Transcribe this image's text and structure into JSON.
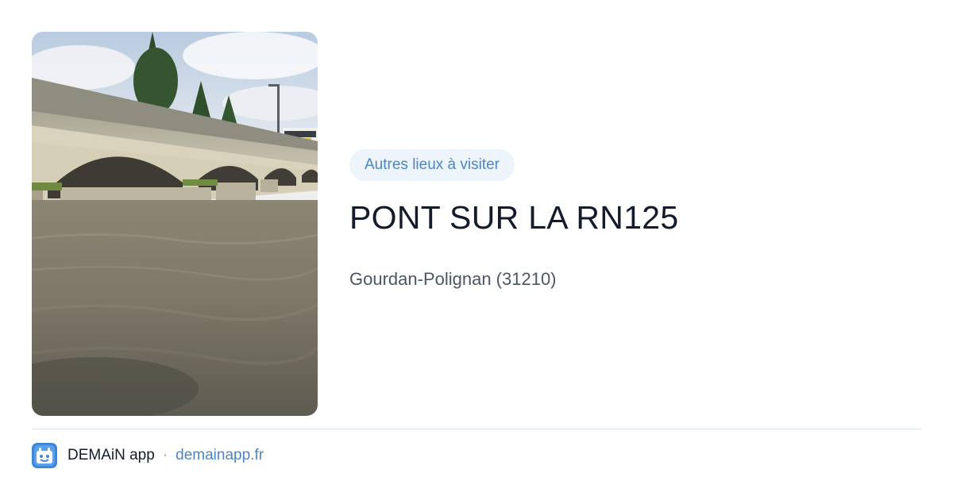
{
  "photo": {
    "icon": "bridge-photo"
  },
  "badge": {
    "label": "Autres lieux à visiter"
  },
  "place": {
    "title": "PONT SUR LA RN125",
    "location": "Gourdan-Polignan (31210)"
  },
  "footer": {
    "logo_icon": "demain-app-icon",
    "brand": "DEMAiN app",
    "separator": "·",
    "link": "demainapp.fr"
  },
  "colors": {
    "accent": "#4a86c8",
    "badge_bg": "#eef4fb",
    "title": "#141c2c",
    "location": "#4c5566",
    "divider": "#d8e4ea"
  }
}
